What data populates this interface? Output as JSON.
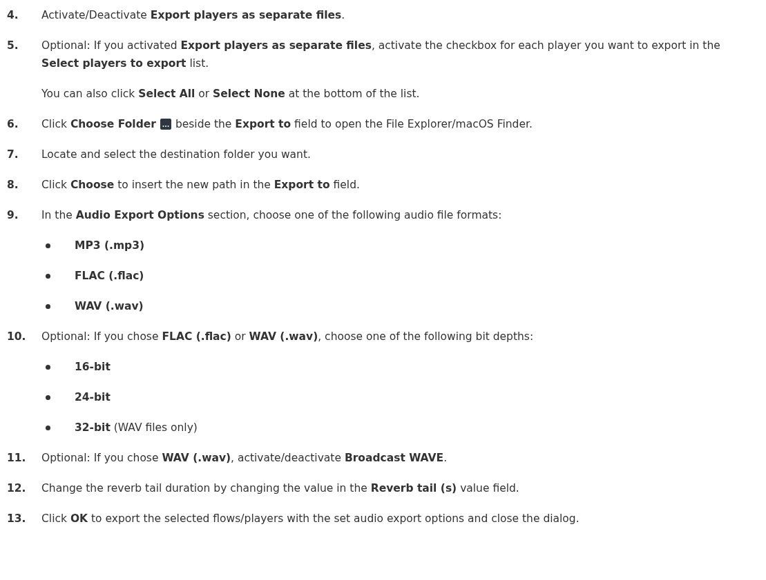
{
  "steps": [
    {
      "number": "4.",
      "text": "Activate/Deactivate **Export players as separate files**."
    },
    {
      "number": "5.",
      "text": "Optional: If you activated **Export players as separate files**, activate the checkbox for each player you want to export in the **Select players to export** list.",
      "note": "You can also click **Select All** or **Select None** at the bottom of the list."
    },
    {
      "number": "6.",
      "kind": "with_icon",
      "text": "Click **Choose Folder**",
      "text_after": "beside the **Export to** field to open the File Explorer/macOS Finder."
    },
    {
      "number": "7.",
      "text": "Locate and select the destination folder you want."
    },
    {
      "number": "8.",
      "text": "Click **Choose** to insert the new path in the **Export to** field."
    },
    {
      "number": "9.",
      "text": "In the **Audio Export Options** section, choose one of the following audio file formats:",
      "bullets": [
        "**MP3 (.mp3)**",
        "**FLAC (.flac)**",
        "**WAV (.wav)**"
      ]
    },
    {
      "number": "10.",
      "text": "Optional: If you chose **FLAC (.flac)** or **WAV (.wav)**, choose one of the following bit depths:",
      "bullets": [
        "**16-bit**",
        "**24-bit**",
        "**32-bit** (WAV files only)"
      ]
    },
    {
      "number": "11.",
      "text": "Optional: If you chose **WAV (.wav)**, activate/deactivate **Broadcast WAVE**."
    },
    {
      "number": "12.",
      "text": "Change the reverb tail duration by changing the value in the **Reverb tail (s)** value field."
    },
    {
      "number": "13.",
      "text": "Click **OK** to export the selected flows/players with the set audio export options and close the dialog."
    }
  ]
}
